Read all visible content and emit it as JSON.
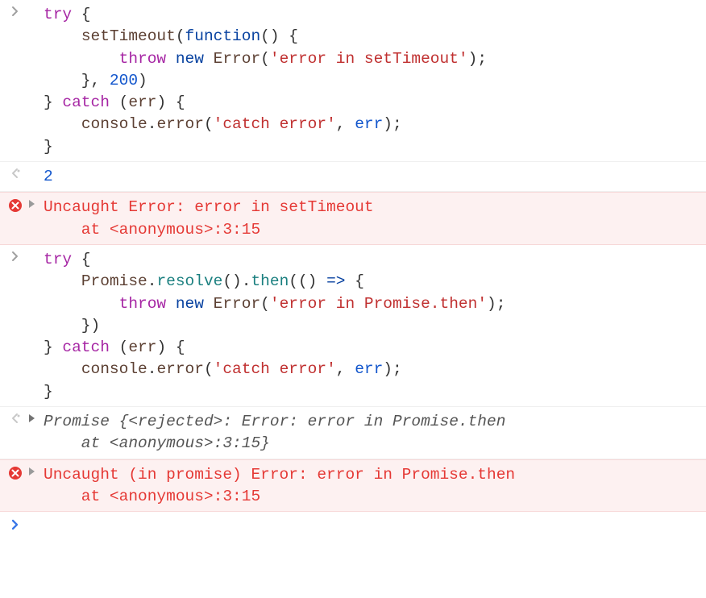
{
  "entries": [
    {
      "id": "input1",
      "type": "input",
      "tokens": [
        {
          "t": "try",
          "c": "kw-purple"
        },
        {
          "t": " {",
          "c": "punct"
        },
        {
          "t": "\n",
          "c": "punct"
        },
        {
          "t": "    ",
          "c": "punct"
        },
        {
          "t": "setTimeout",
          "c": "fn-brown"
        },
        {
          "t": "(",
          "c": "punct"
        },
        {
          "t": "function",
          "c": "kw-blue"
        },
        {
          "t": "() {",
          "c": "punct"
        },
        {
          "t": "\n",
          "c": "punct"
        },
        {
          "t": "        ",
          "c": "punct"
        },
        {
          "t": "throw",
          "c": "kw-purple"
        },
        {
          "t": " ",
          "c": "punct"
        },
        {
          "t": "new",
          "c": "kw-blue"
        },
        {
          "t": " ",
          "c": "punct"
        },
        {
          "t": "Error",
          "c": "fn-brown"
        },
        {
          "t": "(",
          "c": "punct"
        },
        {
          "t": "'error in setTimeout'",
          "c": "str-red"
        },
        {
          "t": ");",
          "c": "punct"
        },
        {
          "t": "\n",
          "c": "punct"
        },
        {
          "t": "    }, ",
          "c": "punct"
        },
        {
          "t": "200",
          "c": "num-blue"
        },
        {
          "t": ")",
          "c": "punct"
        },
        {
          "t": "\n",
          "c": "punct"
        },
        {
          "t": "} ",
          "c": "punct"
        },
        {
          "t": "catch",
          "c": "kw-purple"
        },
        {
          "t": " (",
          "c": "punct"
        },
        {
          "t": "err",
          "c": "fn-brown"
        },
        {
          "t": ") {",
          "c": "punct"
        },
        {
          "t": "\n",
          "c": "punct"
        },
        {
          "t": "    ",
          "c": "punct"
        },
        {
          "t": "console",
          "c": "fn-brown"
        },
        {
          "t": ".",
          "c": "punct"
        },
        {
          "t": "error",
          "c": "fn-brown"
        },
        {
          "t": "(",
          "c": "punct"
        },
        {
          "t": "'catch error'",
          "c": "str-red"
        },
        {
          "t": ", ",
          "c": "punct"
        },
        {
          "t": "err",
          "c": "var-blue"
        },
        {
          "t": ");",
          "c": "punct"
        },
        {
          "t": "\n",
          "c": "punct"
        },
        {
          "t": "}",
          "c": "punct"
        }
      ]
    },
    {
      "id": "output1",
      "type": "output",
      "tokens": [
        {
          "t": "2",
          "c": "num-blue"
        }
      ]
    },
    {
      "id": "error1",
      "type": "error",
      "expandable": true,
      "tokens": [
        {
          "t": "Uncaught Error: error in setTimeout",
          "c": "err-text"
        },
        {
          "t": "\n",
          "c": ""
        },
        {
          "t": "    at <anonymous>:3:15",
          "c": "err-text"
        }
      ]
    },
    {
      "id": "input2",
      "type": "input",
      "tokens": [
        {
          "t": "try",
          "c": "kw-purple"
        },
        {
          "t": " {",
          "c": "punct"
        },
        {
          "t": "\n",
          "c": "punct"
        },
        {
          "t": "    ",
          "c": "punct"
        },
        {
          "t": "Promise",
          "c": "fn-brown"
        },
        {
          "t": ".",
          "c": "punct"
        },
        {
          "t": "resolve",
          "c": "kw-teal"
        },
        {
          "t": "().",
          "c": "punct"
        },
        {
          "t": "then",
          "c": "kw-teal"
        },
        {
          "t": "(() ",
          "c": "punct"
        },
        {
          "t": "=>",
          "c": "kw-blue"
        },
        {
          "t": " {",
          "c": "punct"
        },
        {
          "t": "\n",
          "c": "punct"
        },
        {
          "t": "        ",
          "c": "punct"
        },
        {
          "t": "throw",
          "c": "kw-purple"
        },
        {
          "t": " ",
          "c": "punct"
        },
        {
          "t": "new",
          "c": "kw-blue"
        },
        {
          "t": " ",
          "c": "punct"
        },
        {
          "t": "Error",
          "c": "fn-brown"
        },
        {
          "t": "(",
          "c": "punct"
        },
        {
          "t": "'error in Promise.then'",
          "c": "str-red"
        },
        {
          "t": ");",
          "c": "punct"
        },
        {
          "t": "\n",
          "c": "punct"
        },
        {
          "t": "    })",
          "c": "punct"
        },
        {
          "t": "\n",
          "c": "punct"
        },
        {
          "t": "} ",
          "c": "punct"
        },
        {
          "t": "catch",
          "c": "kw-purple"
        },
        {
          "t": " (",
          "c": "punct"
        },
        {
          "t": "err",
          "c": "fn-brown"
        },
        {
          "t": ") {",
          "c": "punct"
        },
        {
          "t": "\n",
          "c": "punct"
        },
        {
          "t": "    ",
          "c": "punct"
        },
        {
          "t": "console",
          "c": "fn-brown"
        },
        {
          "t": ".",
          "c": "punct"
        },
        {
          "t": "error",
          "c": "fn-brown"
        },
        {
          "t": "(",
          "c": "punct"
        },
        {
          "t": "'catch error'",
          "c": "str-red"
        },
        {
          "t": ", ",
          "c": "punct"
        },
        {
          "t": "err",
          "c": "var-blue"
        },
        {
          "t": ");",
          "c": "punct"
        },
        {
          "t": "\n",
          "c": "punct"
        },
        {
          "t": "}",
          "c": "punct"
        }
      ]
    },
    {
      "id": "output2",
      "type": "output",
      "expandable": true,
      "italic": true,
      "tokens": [
        {
          "t": "Promise {",
          "c": "grey-it"
        },
        {
          "t": "<rejected>",
          "c": "grey-it"
        },
        {
          "t": ": Error: error in Promise.then",
          "c": "grey-it"
        },
        {
          "t": "\n",
          "c": ""
        },
        {
          "t": "    at <anonymous>:3:15}",
          "c": "grey-it"
        }
      ]
    },
    {
      "id": "error2",
      "type": "error",
      "expandable": true,
      "tokens": [
        {
          "t": "Uncaught (in promise) Error: error in Promise.then",
          "c": "err-text"
        },
        {
          "t": "\n",
          "c": ""
        },
        {
          "t": "    at <anonymous>:3:15",
          "c": "err-text"
        }
      ]
    }
  ],
  "prompt": {
    "active": true
  }
}
